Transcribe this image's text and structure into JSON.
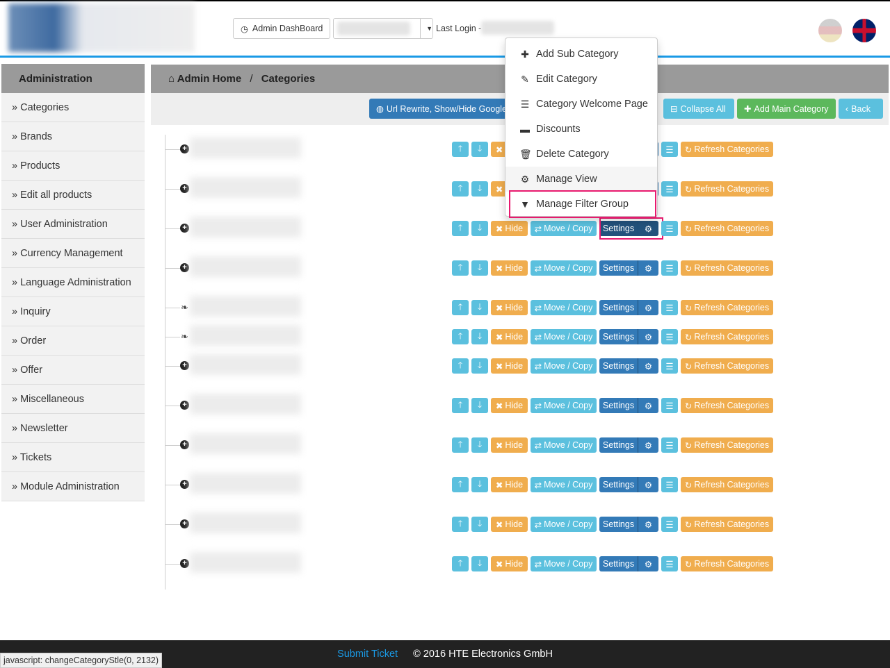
{
  "header": {
    "dashboard_label": "Admin DashBoard",
    "last_login_label": "Last Login -"
  },
  "sidebar": {
    "title": "Administration",
    "items": [
      "Categories",
      "Brands",
      "Products",
      "Edit all products",
      "User Administration",
      "Currency Management",
      "Language Administration",
      "Inquiry",
      "Order",
      "Offer",
      "Miscellaneous",
      "Newsletter",
      "Tickets",
      "Module Administration"
    ]
  },
  "breadcrumb": {
    "home": "Admin Home",
    "separator": "/",
    "current": "Categories"
  },
  "toolbar": {
    "url_rewrite": "Url Rewrite, Show/Hide Google",
    "collapse_all": "Collapse All",
    "add_main": "Add Main Category",
    "back": "Back"
  },
  "row_buttons": {
    "hide": "Hide",
    "move_copy": "Move / Copy",
    "settings": "Settings",
    "refresh": "Refresh Categories"
  },
  "rows": [
    {
      "icon": "plus-circle"
    },
    {
      "icon": "plus-circle"
    },
    {
      "icon": "plus-circle"
    },
    {
      "icon": "plus-circle"
    },
    {
      "icon": "leaf"
    },
    {
      "icon": "leaf"
    },
    {
      "icon": "plus-circle"
    },
    {
      "icon": "plus-circle"
    },
    {
      "icon": "plus-circle"
    },
    {
      "icon": "plus-circle"
    },
    {
      "icon": "plus-circle"
    },
    {
      "icon": "plus-circle"
    }
  ],
  "dropdown": {
    "items": [
      {
        "icon": "plus",
        "label": "Add Sub Category"
      },
      {
        "icon": "edit",
        "label": "Edit Category"
      },
      {
        "icon": "list",
        "label": "Category Welcome Page"
      },
      {
        "icon": "minus",
        "label": "Discounts"
      },
      {
        "icon": "trash",
        "label": "Delete Category"
      },
      {
        "icon": "gear",
        "label": "Manage View"
      },
      {
        "icon": "filter",
        "label": "Manage Filter Group"
      }
    ]
  },
  "footer": {
    "submit_ticket": "Submit Ticket",
    "copyright": "© 2016 HTE Electronics GmbH"
  },
  "status_bar": "javascript: changeCategoryStle(0, 2132)",
  "colors": {
    "accent_line": "#1a9ae6",
    "info": "#5bc0de",
    "warning": "#f0ad4e",
    "primary": "#337ab7",
    "success": "#5cb85c",
    "highlight": "#e8196e"
  }
}
